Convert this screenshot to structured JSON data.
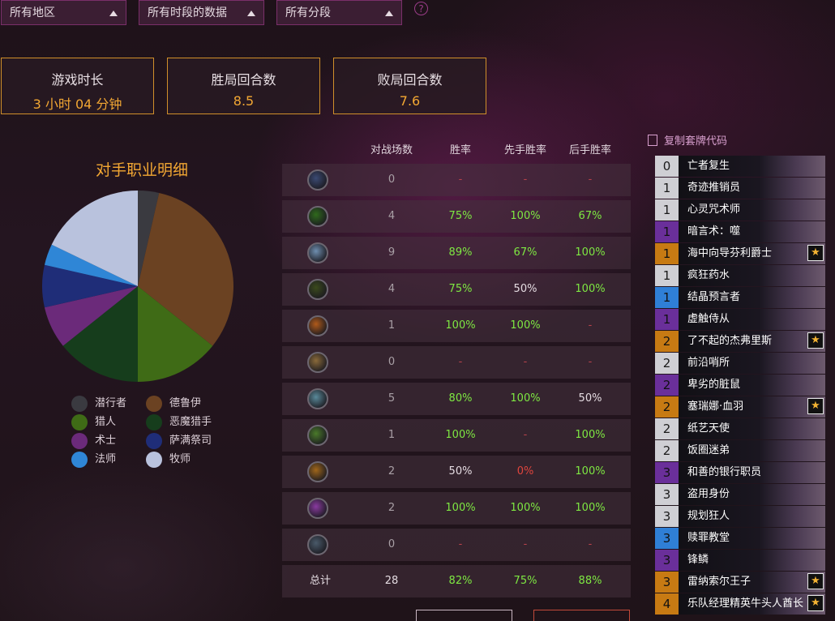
{
  "filters": [
    {
      "label": "所有地区"
    },
    {
      "label": "所有时段的数据"
    },
    {
      "label": "所有分段"
    }
  ],
  "help": "?",
  "stats": [
    {
      "label": "游戏时长",
      "value": "3 小时 04 分钟"
    },
    {
      "label": "胜局回合数",
      "value": "8.5"
    },
    {
      "label": "败局回合数",
      "value": "7.6"
    }
  ],
  "pie": {
    "title": "对手职业明细",
    "legend": [
      {
        "label": "潜行者",
        "color": "#3a3a40"
      },
      {
        "label": "德鲁伊",
        "color": "#6b4222"
      },
      {
        "label": "猎人",
        "color": "#3f6b16"
      },
      {
        "label": "恶魔猎手",
        "color": "#163d1c"
      },
      {
        "label": "术士",
        "color": "#6b2a7a"
      },
      {
        "label": "萨满祭司",
        "color": "#1f2d78"
      },
      {
        "label": "法师",
        "color": "#2f86d6"
      },
      {
        "label": "牧师",
        "color": "#b9c2dd"
      }
    ]
  },
  "chart_data": {
    "type": "pie",
    "title": "对手职业明细",
    "slices": [
      {
        "label": "潜行者",
        "value": 1,
        "color": "#3a3a40"
      },
      {
        "label": "德鲁伊",
        "value": 9,
        "color": "#6b4222"
      },
      {
        "label": "猎人",
        "value": 4,
        "color": "#3f6b16"
      },
      {
        "label": "恶魔猎手",
        "value": 4,
        "color": "#163d1c"
      },
      {
        "label": "术士",
        "value": 2,
        "color": "#6b2a7a"
      },
      {
        "label": "萨满祭司",
        "value": 2,
        "color": "#1f2d78"
      },
      {
        "label": "法师",
        "value": 1,
        "color": "#2f86d6"
      },
      {
        "label": "牧师",
        "value": 5,
        "color": "#b9c2dd"
      }
    ]
  },
  "table": {
    "headers": [
      "对战场数",
      "胜率",
      "先手胜率",
      "后手胜率"
    ],
    "rows": [
      {
        "icon": "death-knight-icon",
        "color": "#3b4a73",
        "games": "0",
        "wr": "-",
        "first": "-",
        "second": "-"
      },
      {
        "icon": "demon-hunter-icon",
        "color": "#2f6a1c",
        "games": "4",
        "wr": "75%",
        "first": "100%",
        "second": "67%"
      },
      {
        "icon": "druid-icon",
        "color": "#6f8fb0",
        "games": "9",
        "wr": "89%",
        "first": "67%",
        "second": "100%"
      },
      {
        "icon": "hunter-icon",
        "color": "#3b4a1c",
        "games": "4",
        "wr": "75%",
        "first": "50%",
        "second": "100%"
      },
      {
        "icon": "mage-icon",
        "color": "#b05a1a",
        "games": "1",
        "wr": "100%",
        "first": "100%",
        "second": "-"
      },
      {
        "icon": "paladin-icon",
        "color": "#8a6a3a",
        "games": "0",
        "wr": "-",
        "first": "-",
        "second": "-"
      },
      {
        "icon": "priest-icon",
        "color": "#5a8a9a",
        "games": "5",
        "wr": "80%",
        "first": "100%",
        "second": "50%"
      },
      {
        "icon": "rogue-icon",
        "color": "#4a7a2a",
        "games": "1",
        "wr": "100%",
        "first": "-",
        "second": "100%"
      },
      {
        "icon": "shaman-icon",
        "color": "#a0661a",
        "games": "2",
        "wr": "50%",
        "first": "0%",
        "second": "100%"
      },
      {
        "icon": "warlock-icon",
        "color": "#8a3aa0",
        "games": "2",
        "wr": "100%",
        "first": "100%",
        "second": "100%"
      },
      {
        "icon": "warrior-icon",
        "color": "#4a5a6a",
        "games": "0",
        "wr": "-",
        "first": "-",
        "second": "-"
      }
    ],
    "total": {
      "label": "总计",
      "games": "28",
      "wr": "82%",
      "first": "75%",
      "second": "88%"
    }
  },
  "deck": {
    "copy_label": "复制套牌代码",
    "cards": [
      {
        "cost": "0",
        "name": "亡者复生",
        "rarity": "common",
        "star": false
      },
      {
        "cost": "1",
        "name": "奇迹推销员",
        "rarity": "common",
        "star": false
      },
      {
        "cost": "1",
        "name": "心灵咒术师",
        "rarity": "common",
        "star": false
      },
      {
        "cost": "1",
        "name": "暗言术：噬",
        "rarity": "epic",
        "star": false
      },
      {
        "cost": "1",
        "name": "海中向导芬利爵士",
        "rarity": "legendary",
        "star": true
      },
      {
        "cost": "1",
        "name": "疯狂药水",
        "rarity": "common",
        "star": false
      },
      {
        "cost": "1",
        "name": "结晶预言者",
        "rarity": "rare",
        "star": false
      },
      {
        "cost": "1",
        "name": "虚触侍从",
        "rarity": "epic",
        "star": false
      },
      {
        "cost": "2",
        "name": "了不起的杰弗里斯",
        "rarity": "legendary",
        "star": true
      },
      {
        "cost": "2",
        "name": "前沿哨所",
        "rarity": "common",
        "star": false
      },
      {
        "cost": "2",
        "name": "卑劣的脏鼠",
        "rarity": "epic",
        "star": false
      },
      {
        "cost": "2",
        "name": "塞瑞娜·血羽",
        "rarity": "legendary",
        "star": true
      },
      {
        "cost": "2",
        "name": "纸艺天使",
        "rarity": "common",
        "star": false
      },
      {
        "cost": "2",
        "name": "饭圈迷弟",
        "rarity": "common",
        "star": false
      },
      {
        "cost": "3",
        "name": "和善的银行职员",
        "rarity": "epic",
        "star": false
      },
      {
        "cost": "3",
        "name": "盗用身份",
        "rarity": "common",
        "star": false
      },
      {
        "cost": "3",
        "name": "规划狂人",
        "rarity": "common",
        "star": false
      },
      {
        "cost": "3",
        "name": "赎罪教堂",
        "rarity": "rare",
        "star": false
      },
      {
        "cost": "3",
        "name": "锋鳞",
        "rarity": "epic",
        "star": false
      },
      {
        "cost": "3",
        "name": "雷纳索尔王子",
        "rarity": "legendary",
        "star": true
      },
      {
        "cost": "4",
        "name": "乐队经理精英牛头人酋长",
        "rarity": "legendary",
        "star": true
      }
    ]
  },
  "rarity_colors": {
    "common": "#cfcfd4",
    "rare": "#2f7fd6",
    "epic": "#6a2f9a",
    "legendary": "#c77a13"
  }
}
